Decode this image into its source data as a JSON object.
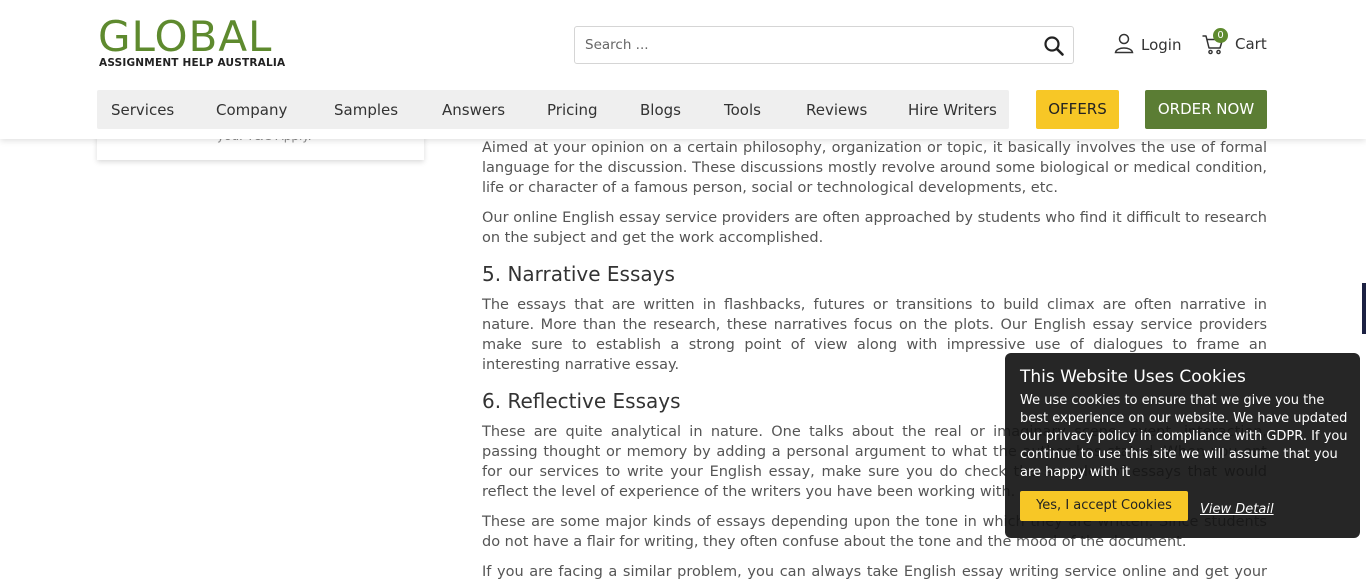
{
  "logo": {
    "name": "GLOBAL",
    "tagline": "ASSIGNMENT HELP AUSTRALIA",
    "brand_color": "#5e8a2e"
  },
  "search": {
    "placeholder": "Search ...",
    "icon": "search-icon"
  },
  "header": {
    "login_label": "Login",
    "cart_label": "Cart",
    "cart_count": "0"
  },
  "nav": {
    "items": [
      "Services",
      "Company",
      "Samples",
      "Answers",
      "Pricing",
      "Blogs",
      "Tools",
      "Reviews",
      "Hire Writers"
    ],
    "offers_label": "OFFERS",
    "order_label": "ORDER NOW",
    "offers_color": "#f7c726",
    "order_color": "#5b7d34"
  },
  "sidebar": {
    "card_text": "you. T&C Apply."
  },
  "article": {
    "p1": "Aimed at your opinion on a certain philosophy, organization or topic, it basically involves the use of formal language for the discussion. These discussions mostly revolve around some biological or medical condition, life or character of a famous person, social or technological developments, etc.",
    "p2": "Our online English essay service providers are often approached by students who find it difficult to research on the subject and get the work accomplished.",
    "h_narrative": "5. Narrative Essays",
    "p3": "The essays that are written in flashbacks, futures or transitions to build climax are often narrative in nature. More than the research, these narratives focus on the plots. Our English essay service providers make sure to establish a strong point of view along with impressive use of dialogues to frame an interesting narrative essay.",
    "h_reflective": "6. Reflective Essays",
    "p4": "These are quite analytical in nature. One talks about the real or imaginary scene, event, interaction, passing thought or memory by adding a personal argument to what the author has stated. When you opt for our services to write your English essay, make sure you do check the samples of essays that would reflect the level of experience of the writers you have been working with.",
    "p5": "These are some major kinds of essays depending upon the tone in which they are written. Since students do not have a flair for writing, they often confuse about the tone and the mood of the document.",
    "p6": "If you are facing a similar problem, you can always take English essay writing service online and get your work accomplished in limited time."
  },
  "cookie": {
    "title": "This Website Uses Cookies",
    "body": "We use cookies to ensure that we give you the best experience on our website. We have updated our privacy policy in compliance with GDPR. If you continue to use this site we will assume that you are happy with it",
    "accept_label": "Yes, I accept Cookies",
    "detail_label": "View Detail"
  }
}
